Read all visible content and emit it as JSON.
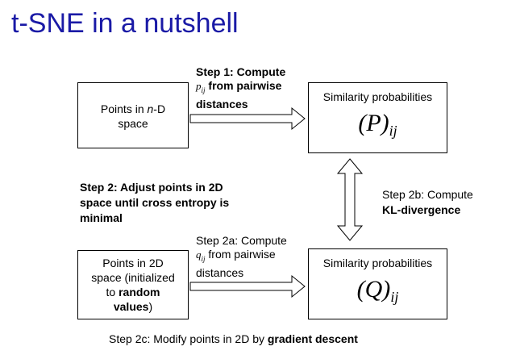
{
  "title": "t-SNE in a nutshell",
  "box_points_nd": {
    "line1_prefix": "Points in ",
    "line1_var": "n",
    "line1_suffix": "-D",
    "line2": "space"
  },
  "box_sim_p": {
    "label": "Similarity probabilities",
    "symbol": "(P)",
    "subscript": "ij"
  },
  "box_points_2d": {
    "line1": "Points in 2D",
    "line2": "space (initialized",
    "line3_prefix": "to ",
    "line3_bold": "random",
    "line4_bold": "values",
    "line4_suffix": ")"
  },
  "box_sim_q": {
    "label": "Similarity probabilities",
    "symbol": "(Q)",
    "subscript": "ij"
  },
  "step1": {
    "line1": "Step 1: Compute",
    "var": "p",
    "var_sub": "ij",
    "line2_rest": " from pairwise",
    "line3": "distances"
  },
  "step2": {
    "line1": "Step 2: Adjust points in 2D",
    "line2": "space until cross entropy is",
    "line3": "minimal"
  },
  "step2a": {
    "line1": "Step 2a: Compute",
    "var": "q",
    "var_sub": "ij",
    "line2_rest": " from pairwise",
    "line3": "distances"
  },
  "step2b": {
    "line1": "Step 2b: Compute",
    "line2_bold": "KL-divergence"
  },
  "step2c": {
    "prefix": "Step 2c: Modify points in 2D by ",
    "bold": "gradient descent"
  }
}
